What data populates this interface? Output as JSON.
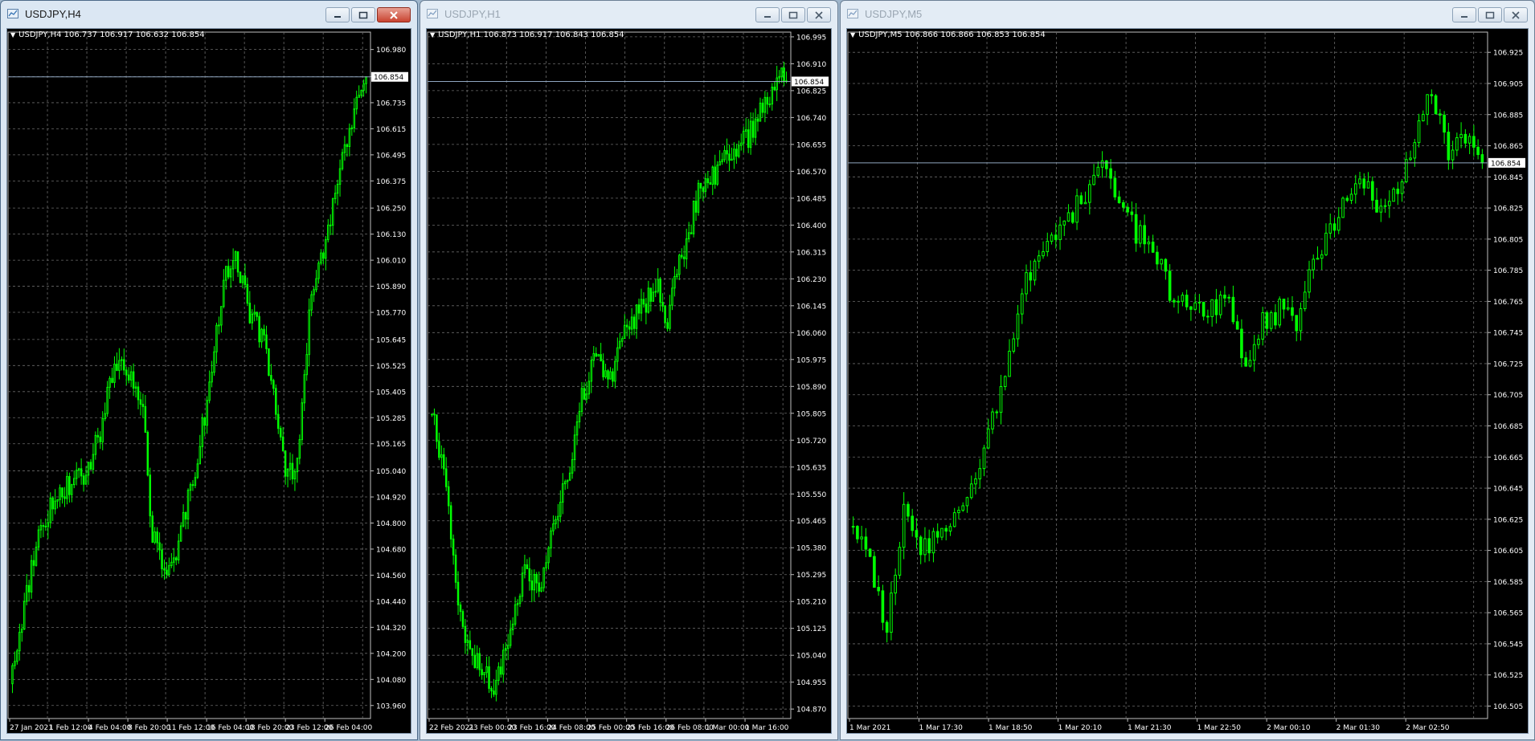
{
  "colors": {
    "background": "#000000",
    "grid": "#6a6a6a",
    "candle": "#00ff00",
    "text": "#ffffff",
    "bid_line": "#8fa6bf"
  },
  "windows": [
    {
      "title": "USDJPY,H4",
      "active": true,
      "icon": "chart-icon",
      "header": "USDJPY,H4  106.737 106.917 106.632 106.854",
      "bid_label": "106.854",
      "chart_data": {
        "type": "candlestick",
        "symbol": "USDJPY",
        "timeframe": "H4",
        "ohlc": {
          "open": 106.737,
          "high": 106.917,
          "low": 106.632,
          "close": 106.854
        },
        "bid": 106.854,
        "ylim": [
          103.9,
          107.06
        ],
        "y_ticks": [
          "106.980",
          "106.855",
          "106.735",
          "106.615",
          "106.495",
          "106.375",
          "106.250",
          "106.130",
          "106.010",
          "105.890",
          "105.770",
          "105.645",
          "105.525",
          "105.405",
          "105.285",
          "105.165",
          "105.040",
          "104.920",
          "104.800",
          "104.680",
          "104.560",
          "104.440",
          "104.320",
          "104.200",
          "104.080",
          "103.960"
        ],
        "x_ticks": [
          "27 Jan 2021",
          "1 Feb 12:00",
          "4 Feb 04:00",
          "8 Feb 20:00",
          "11 Feb 12:00",
          "16 Feb 04:00",
          "18 Feb 20:00",
          "23 Feb 12:00",
          "26 Feb 04:00"
        ],
        "x_tick_offsets": [
          0,
          17,
          34,
          51,
          68,
          85,
          102,
          119,
          136
        ],
        "n_candles": 150,
        "anchors": [
          [
            0,
            104.06
          ],
          [
            6,
            104.42
          ],
          [
            12,
            104.75
          ],
          [
            20,
            104.95
          ],
          [
            30,
            105.0
          ],
          [
            38,
            105.2
          ],
          [
            44,
            105.55
          ],
          [
            50,
            105.5
          ],
          [
            56,
            105.3
          ],
          [
            60,
            104.75
          ],
          [
            65,
            104.55
          ],
          [
            70,
            104.65
          ],
          [
            76,
            104.95
          ],
          [
            83,
            105.35
          ],
          [
            90,
            105.9
          ],
          [
            95,
            106.05
          ],
          [
            101,
            105.75
          ],
          [
            107,
            105.65
          ],
          [
            112,
            105.35
          ],
          [
            117,
            105.0
          ],
          [
            121,
            105.1
          ],
          [
            126,
            105.75
          ],
          [
            131,
            106.0
          ],
          [
            137,
            106.3
          ],
          [
            143,
            106.6
          ],
          [
            147,
            106.8
          ],
          [
            149,
            106.854
          ]
        ],
        "show_grid": true
      }
    },
    {
      "title": "USDJPY,H1",
      "active": false,
      "icon": "chart-icon",
      "header": "USDJPY,H1  106.873 106.917 106.843 106.854",
      "bid_label": "106.854",
      "chart_data": {
        "type": "candlestick",
        "symbol": "USDJPY",
        "timeframe": "H1",
        "ohlc": {
          "open": 106.873,
          "high": 106.917,
          "low": 106.843,
          "close": 106.854
        },
        "bid": 106.854,
        "ylim": [
          104.84,
          107.01
        ],
        "y_ticks": [
          "106.995",
          "106.910",
          "106.825",
          "106.740",
          "106.655",
          "106.570",
          "106.485",
          "106.400",
          "106.315",
          "106.230",
          "106.145",
          "106.060",
          "105.975",
          "105.890",
          "105.805",
          "105.720",
          "105.635",
          "105.550",
          "105.465",
          "105.380",
          "105.295",
          "105.210",
          "105.125",
          "105.040",
          "104.955",
          "104.870"
        ],
        "x_ticks": [
          "22 Feb 2021",
          "23 Feb 00:00",
          "23 Feb 16:00",
          "24 Feb 08:00",
          "25 Feb 00:00",
          "25 Feb 16:00",
          "26 Feb 08:00",
          "1 Mar 00:00",
          "1 Mar 16:00"
        ],
        "x_tick_offsets": [
          0,
          16,
          32,
          48,
          64,
          80,
          96,
          112,
          128
        ],
        "n_candles": 150,
        "anchors": [
          [
            0,
            105.8
          ],
          [
            3,
            105.75
          ],
          [
            8,
            105.5
          ],
          [
            12,
            105.2
          ],
          [
            16,
            105.05
          ],
          [
            22,
            105.0
          ],
          [
            27,
            104.92
          ],
          [
            33,
            105.1
          ],
          [
            40,
            105.3
          ],
          [
            46,
            105.25
          ],
          [
            52,
            105.45
          ],
          [
            58,
            105.6
          ],
          [
            64,
            105.85
          ],
          [
            70,
            106.0
          ],
          [
            76,
            105.9
          ],
          [
            82,
            106.05
          ],
          [
            90,
            106.15
          ],
          [
            96,
            106.2
          ],
          [
            100,
            106.1
          ],
          [
            104,
            106.25
          ],
          [
            108,
            106.35
          ],
          [
            113,
            106.5
          ],
          [
            118,
            106.55
          ],
          [
            124,
            106.6
          ],
          [
            130,
            106.65
          ],
          [
            136,
            106.7
          ],
          [
            141,
            106.78
          ],
          [
            146,
            106.87
          ],
          [
            149,
            106.854
          ]
        ],
        "show_grid": true
      }
    },
    {
      "title": "USDJPY,M5",
      "active": false,
      "icon": "chart-icon",
      "header": "USDJPY,M5  106.866 106.866 106.853 106.854",
      "bid_label": "106.854",
      "chart_data": {
        "type": "candlestick",
        "symbol": "USDJPY",
        "timeframe": "M5",
        "ohlc": {
          "open": 106.866,
          "high": 106.866,
          "low": 106.853,
          "close": 106.854
        },
        "bid": 106.854,
        "ylim": [
          106.497,
          106.938
        ],
        "y_ticks": [
          "106.925",
          "106.905",
          "106.885",
          "106.865",
          "106.845",
          "106.825",
          "106.805",
          "106.785",
          "106.765",
          "106.745",
          "106.725",
          "106.705",
          "106.685",
          "106.665",
          "106.645",
          "106.625",
          "106.605",
          "106.585",
          "106.565",
          "106.545",
          "106.525",
          "106.505"
        ],
        "x_ticks": [
          "1 Mar 2021",
          "1 Mar 17:30",
          "1 Mar 18:50",
          "1 Mar 20:10",
          "1 Mar 21:30",
          "1 Mar 22:50",
          "2 Mar 00:10",
          "2 Mar 01:30",
          "2 Mar 02:50"
        ],
        "x_tick_offsets": [
          0,
          16,
          32,
          48,
          64,
          80,
          96,
          112,
          128
        ],
        "n_candles": 150,
        "anchors": [
          [
            0,
            106.62
          ],
          [
            5,
            106.6
          ],
          [
            9,
            106.55
          ],
          [
            13,
            106.63
          ],
          [
            17,
            106.6
          ],
          [
            21,
            106.62
          ],
          [
            25,
            106.63
          ],
          [
            30,
            106.65
          ],
          [
            35,
            106.7
          ],
          [
            40,
            106.76
          ],
          [
            45,
            106.8
          ],
          [
            50,
            106.81
          ],
          [
            55,
            106.83
          ],
          [
            60,
            106.86
          ],
          [
            64,
            106.83
          ],
          [
            68,
            106.81
          ],
          [
            72,
            106.8
          ],
          [
            76,
            106.77
          ],
          [
            80,
            106.76
          ],
          [
            85,
            106.76
          ],
          [
            90,
            106.77
          ],
          [
            94,
            106.72
          ],
          [
            98,
            106.75
          ],
          [
            102,
            106.76
          ],
          [
            106,
            106.75
          ],
          [
            110,
            106.79
          ],
          [
            114,
            106.81
          ],
          [
            118,
            106.83
          ],
          [
            122,
            106.84
          ],
          [
            126,
            106.82
          ],
          [
            130,
            106.84
          ],
          [
            134,
            106.87
          ],
          [
            138,
            106.9
          ],
          [
            142,
            106.86
          ],
          [
            146,
            106.87
          ],
          [
            149,
            106.854
          ]
        ],
        "show_grid": true
      }
    }
  ]
}
